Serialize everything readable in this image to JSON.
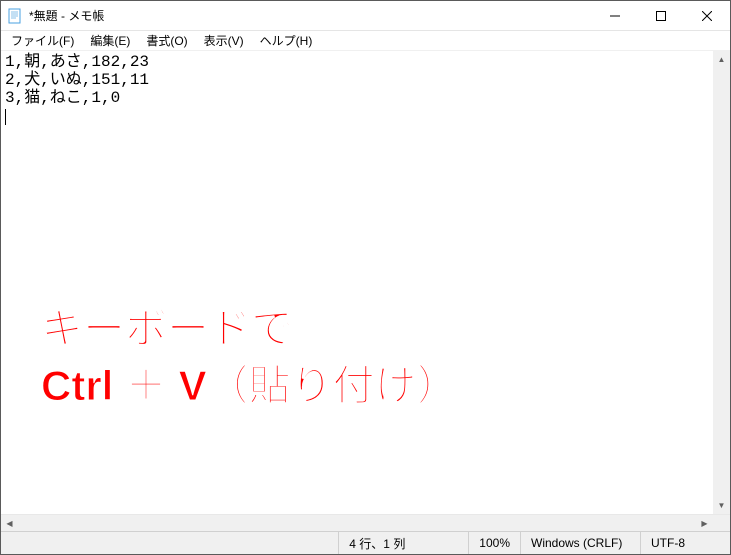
{
  "window": {
    "title": "*無題 - メモ帳"
  },
  "menu": {
    "file": "ファイル(F)",
    "edit": "編集(E)",
    "format": "書式(O)",
    "view": "表示(V)",
    "help": "ヘルプ(H)"
  },
  "editor": {
    "line1": "1,朝,あさ,182,23",
    "line2": "2,犬,いぬ,151,11",
    "line3": "3,猫,ねこ,1,0"
  },
  "status": {
    "position": "4 行、1 列",
    "zoom": "100%",
    "line_ending": "Windows (CRLF)",
    "encoding": "UTF-8"
  },
  "annotation": {
    "line1": "キーボードで",
    "line2": "Ctrl ＋ V（貼り付け）"
  }
}
